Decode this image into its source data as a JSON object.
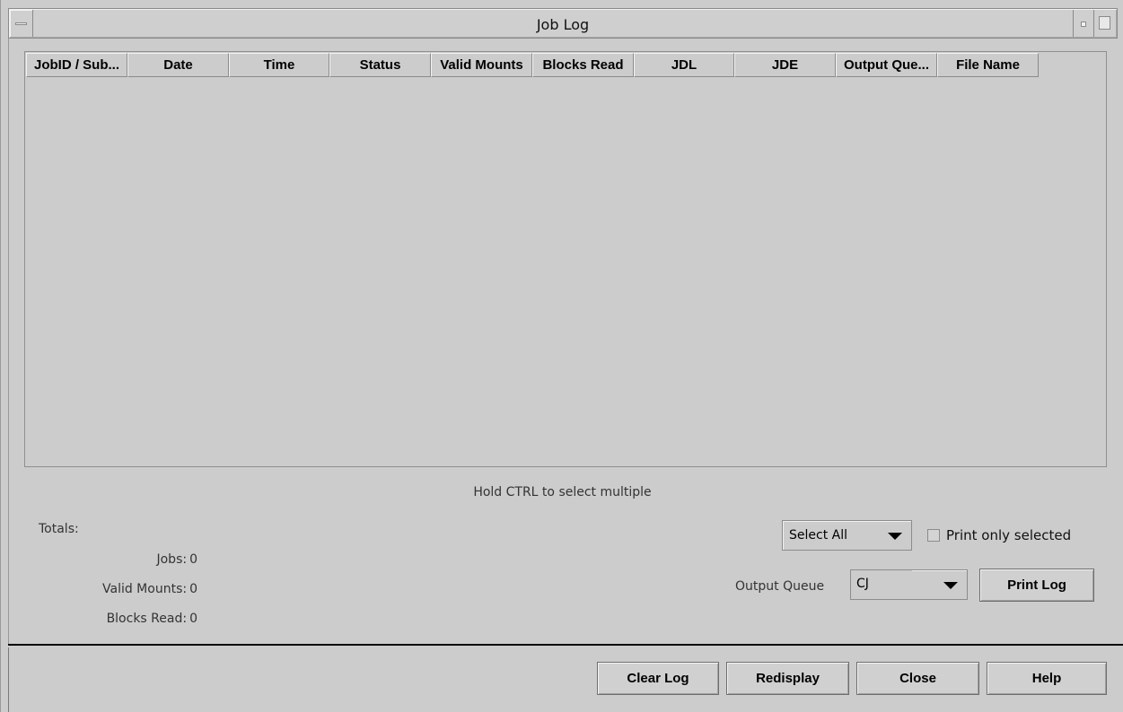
{
  "window": {
    "title": "Job Log"
  },
  "table": {
    "columns": [
      {
        "label": "JobID / Sub..."
      },
      {
        "label": "Date"
      },
      {
        "label": "Time"
      },
      {
        "label": "Status"
      },
      {
        "label": "Valid Mounts"
      },
      {
        "label": "Blocks Read"
      },
      {
        "label": "JDL"
      },
      {
        "label": "JDE"
      },
      {
        "label": "Output Que..."
      },
      {
        "label": "File Name"
      }
    ],
    "rows": []
  },
  "hint": "Hold CTRL to select multiple",
  "totals": {
    "label": "Totals:",
    "jobs_label": "Jobs:",
    "jobs_value": "0",
    "valid_mounts_label": "Valid Mounts:",
    "valid_mounts_value": "0",
    "blocks_read_label": "Blocks Read:",
    "blocks_read_value": "0"
  },
  "selection": {
    "select_combo_value": "Select All",
    "print_only_selected_label": "Print only selected",
    "print_only_selected_checked": false
  },
  "output_queue": {
    "label": "Output Queue",
    "value": "CJ"
  },
  "buttons": {
    "print_log": "Print Log",
    "clear_log": "Clear Log",
    "redisplay": "Redisplay",
    "close": "Close",
    "help": "Help"
  }
}
